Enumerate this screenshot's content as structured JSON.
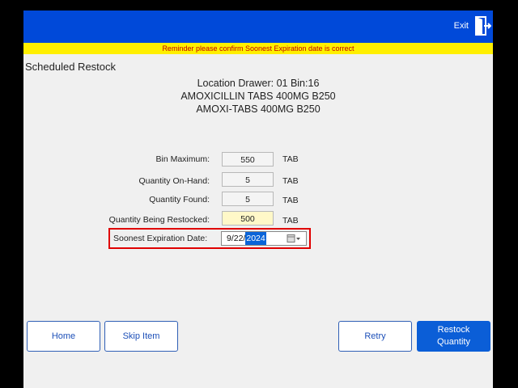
{
  "header": {
    "exit_label": "Exit",
    "reminder": "Reminder please confirm Soonest Expiration date is correct"
  },
  "page_title": "Scheduled Restock",
  "location": {
    "line1": "Location Drawer: 01 Bin:16",
    "line2": "AMOXICILLIN TABS 400MG B250",
    "line3": "AMOXI-TABS 400MG B250"
  },
  "fields": {
    "bin_maximum": {
      "label": "Bin Maximum:",
      "value": "550",
      "unit": "TAB"
    },
    "quantity_on_hand": {
      "label": "Quantity On-Hand:",
      "value": "5",
      "unit": "TAB"
    },
    "quantity_found": {
      "label": "Quantity Found:",
      "value": "5",
      "unit": "TAB"
    },
    "quantity_restocked": {
      "label": "Quantity Being Restocked:",
      "value": "500",
      "unit": "TAB"
    }
  },
  "expiration": {
    "label": "Soonest Expiration Date:",
    "date_prefix": "9/22/",
    "date_selected": "2024"
  },
  "buttons": {
    "home": "Home",
    "skip_item": "Skip Item",
    "retry": "Retry",
    "restock_line1": "Restock",
    "restock_line2": "Quantity"
  },
  "colors": {
    "header_blue": "#0049d9",
    "reminder_yellow": "#ffef00",
    "reminder_text": "#c00000",
    "highlight_red": "#e00000",
    "primary_button": "#0b5ed7"
  }
}
